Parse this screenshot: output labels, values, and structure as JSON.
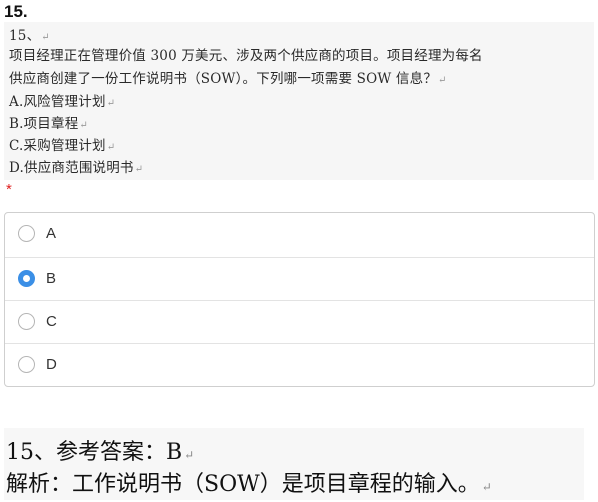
{
  "question": {
    "number": "15.",
    "lines": [
      "15、",
      "项目经理正在管理价值 300 万美元、涉及两个供应商的项目。项目经理为每名",
      "供应商创建了一份工作说明书（SOW）。下列哪一项需要 SOW 信息？",
      "A.风险管理计划",
      "B.项目章程",
      "C.采购管理计划",
      "D.供应商范围说明书"
    ],
    "required_marker": "*"
  },
  "options": [
    {
      "label": "A",
      "selected": false
    },
    {
      "label": "B",
      "selected": true
    },
    {
      "label": "C",
      "selected": false
    },
    {
      "label": "D",
      "selected": false
    }
  ],
  "answer": {
    "line1": "15、参考答案：B",
    "line2": "解析：工作说明书（SOW）是项目章程的输入。"
  },
  "colors": {
    "accent": "#3b8fe6",
    "required": "#e02020"
  }
}
